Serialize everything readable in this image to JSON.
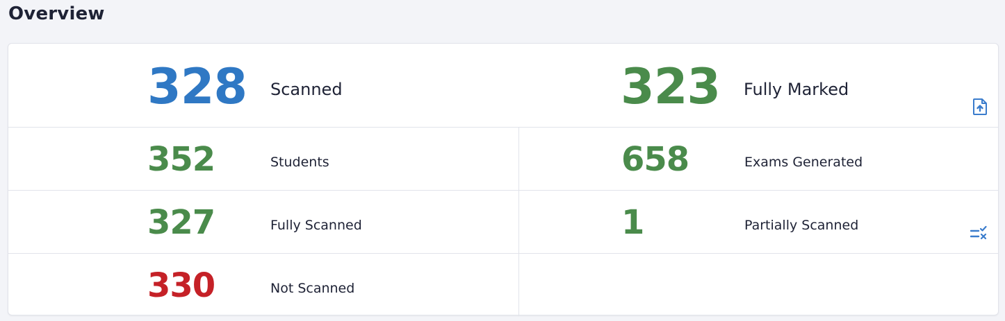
{
  "header": {
    "title": "Overview"
  },
  "colors": {
    "blue": "#2f78c4",
    "green": "#4a8b4b",
    "red": "#c52127",
    "icon": "#3a7ccc"
  },
  "stats": {
    "scanned": {
      "value": "328",
      "label": "Scanned"
    },
    "fully_marked": {
      "value": "323",
      "label": "Fully Marked"
    },
    "students": {
      "value": "352",
      "label": "Students"
    },
    "exams_generated": {
      "value": "658",
      "label": "Exams Generated"
    },
    "fully_scanned": {
      "value": "327",
      "label": "Fully Scanned"
    },
    "partially_scanned": {
      "value": "1",
      "label": "Partially Scanned"
    },
    "not_scanned": {
      "value": "330",
      "label": "Not Scanned"
    }
  },
  "icons": {
    "upload": "file-upload-icon",
    "checklist": "checklist-x-icon"
  }
}
